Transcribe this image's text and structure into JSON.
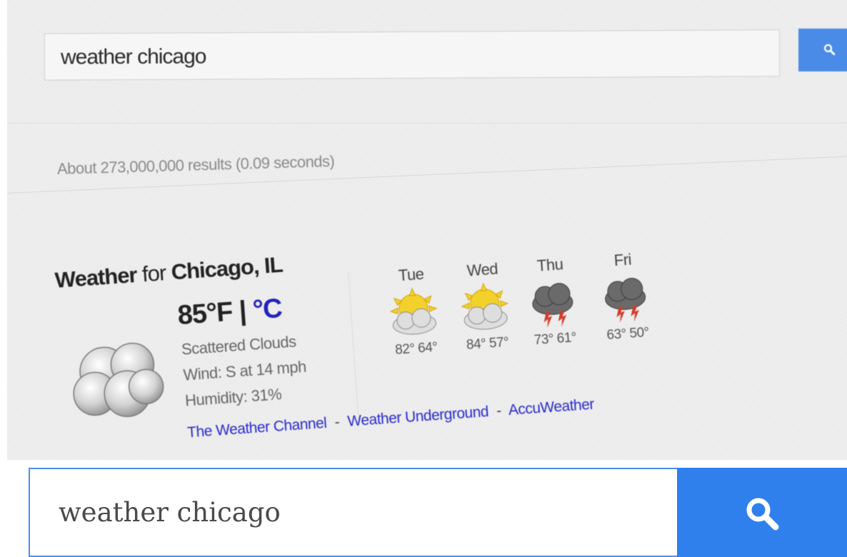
{
  "top_screen": {
    "search_query": "weather chicago",
    "result_stats": "About 273,000,000 results (0.09 seconds)",
    "weather": {
      "title_prefix": "Weather",
      "title_for": "for",
      "location": "Chicago, IL",
      "temp_f": "85°F",
      "temp_sep": "|",
      "temp_c": "°C",
      "condition": "Scattered Clouds",
      "wind": "Wind: S at 14 mph",
      "humidity": "Humidity: 31%",
      "current_icon": "cloud-icon",
      "forecast": [
        {
          "day": "Tue",
          "temps": "82° 64°",
          "icon": "partly-sunny-icon"
        },
        {
          "day": "Wed",
          "temps": "84° 57°",
          "icon": "partly-sunny-icon"
        },
        {
          "day": "Thu",
          "temps": "73° 61°",
          "icon": "thunderstorm-icon"
        },
        {
          "day": "Fri",
          "temps": "63° 50°",
          "icon": "thunderstorm-icon"
        }
      ],
      "sources": [
        "The Weather Channel",
        "Weather Underground",
        "AccuWeather"
      ],
      "source_sep": "-"
    }
  },
  "bottom_search": {
    "query": "weather chicago",
    "button_icon": "search-icon"
  },
  "colors": {
    "search_button": "#2f80ed",
    "input_border": "#4a8ff0",
    "link_blue": "#2a2ad0"
  }
}
